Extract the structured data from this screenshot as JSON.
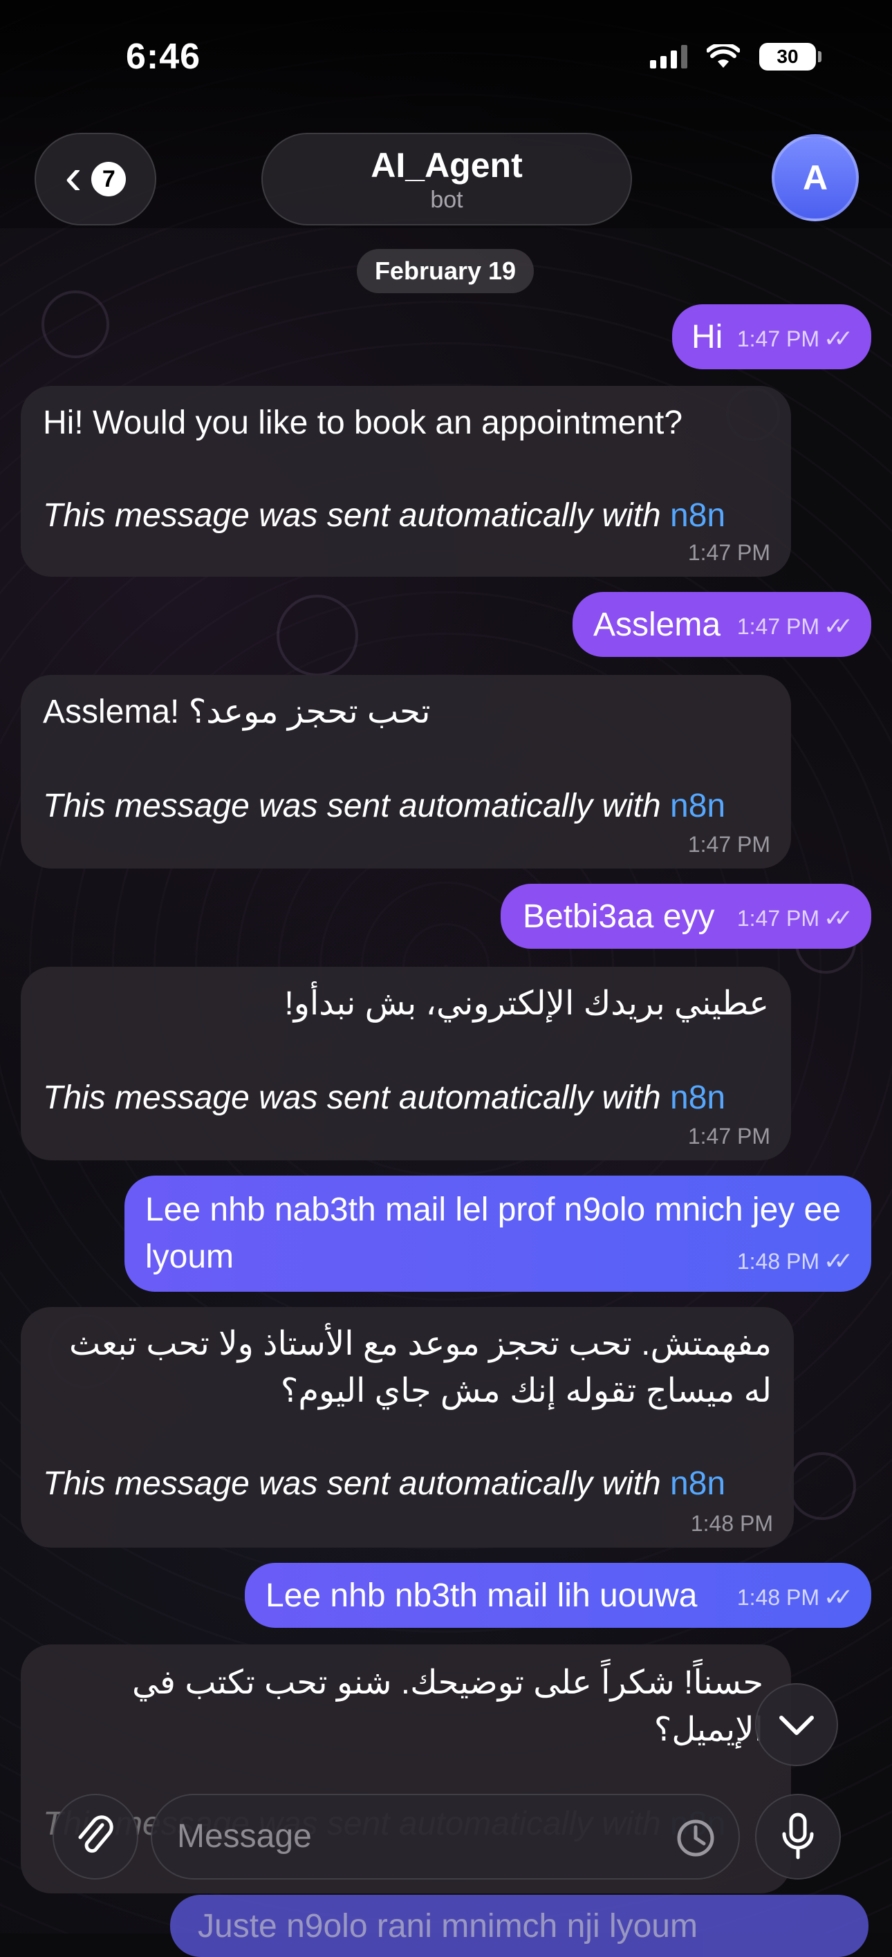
{
  "status_bar": {
    "time": "6:46",
    "battery": "30"
  },
  "header": {
    "back_badge": "7",
    "title": "AI_Agent",
    "subtitle": "bot",
    "avatar_letter": "A"
  },
  "date_chip": "February 19",
  "footer_note": "This message was sent automatically with ",
  "footer_link": "n8n",
  "messages": [
    {
      "dir": "out",
      "text": "Hi",
      "time": "1:47 PM"
    },
    {
      "dir": "in",
      "text": "Hi! Would you like to book an appointment?",
      "time": "1:47 PM"
    },
    {
      "dir": "out",
      "text": "Asslema",
      "time": "1:47 PM"
    },
    {
      "dir": "in",
      "text": "Asslema! تحب تحجز موعد؟",
      "time": "1:47 PM"
    },
    {
      "dir": "out",
      "text": "Betbi3aa eyy",
      "time": "1:47 PM"
    },
    {
      "dir": "in",
      "text": "عطيني بريدك الإلكتروني، بش نبدأو!",
      "time": "1:47 PM"
    },
    {
      "dir": "out",
      "text": "Lee nhb nab3th mail lel prof n9olo mnich jey ee lyoum",
      "time": "1:48 PM"
    },
    {
      "dir": "in",
      "text": "مفهمتش. تحب تحجز موعد مع الأستاذ ولا تحب تبعث له ميساج تقوله إنك مش جاي اليوم؟",
      "time": "1:48 PM"
    },
    {
      "dir": "out",
      "text": "Lee nhb nb3th mail lih uouwa",
      "time": "1:48 PM"
    },
    {
      "dir": "in",
      "text": "حسناً! شكراً على توضيحك. شنو تحب تكتب في الإيميل؟",
      "time": ""
    }
  ],
  "peek_message": "Juste n9olo rani mnimch nji lyoum",
  "composer": {
    "placeholder": "Message"
  },
  "icons": {
    "back": "chevron-left-icon",
    "attach": "paperclip-icon",
    "sticker": "sticker-clock-icon",
    "mic": "microphone-icon",
    "scroll_down": "chevron-down-icon",
    "read": "double-check-icon"
  }
}
